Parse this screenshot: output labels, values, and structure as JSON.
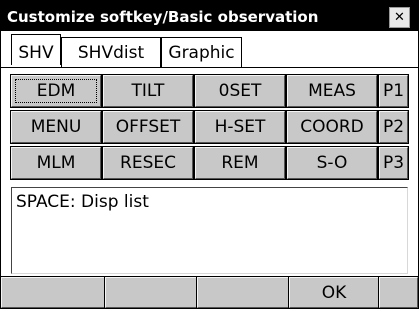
{
  "window": {
    "title": "Customize softkey/Basic observation",
    "close_glyph": "✕"
  },
  "tabs": [
    {
      "label": "SHV",
      "active": true
    },
    {
      "label": "SHVdist",
      "active": false
    },
    {
      "label": "Graphic",
      "active": false
    }
  ],
  "keys": {
    "row1": [
      "EDM",
      "TILT",
      "0SET",
      "MEAS",
      "P1"
    ],
    "row2": [
      "MENU",
      "OFFSET",
      "H-SET",
      "COORD",
      "P2"
    ],
    "row3": [
      "MLM",
      "RESEC",
      "REM",
      "S-O",
      "P3"
    ]
  },
  "selected_key": "EDM",
  "hint_text": "SPACE: Disp list",
  "softkeys": [
    "",
    "",
    "",
    "OK",
    ""
  ],
  "colors": {
    "titlebar_bg": "#000000",
    "key_face": "#c8c8c8"
  },
  "icons": {
    "close": "close-icon"
  }
}
